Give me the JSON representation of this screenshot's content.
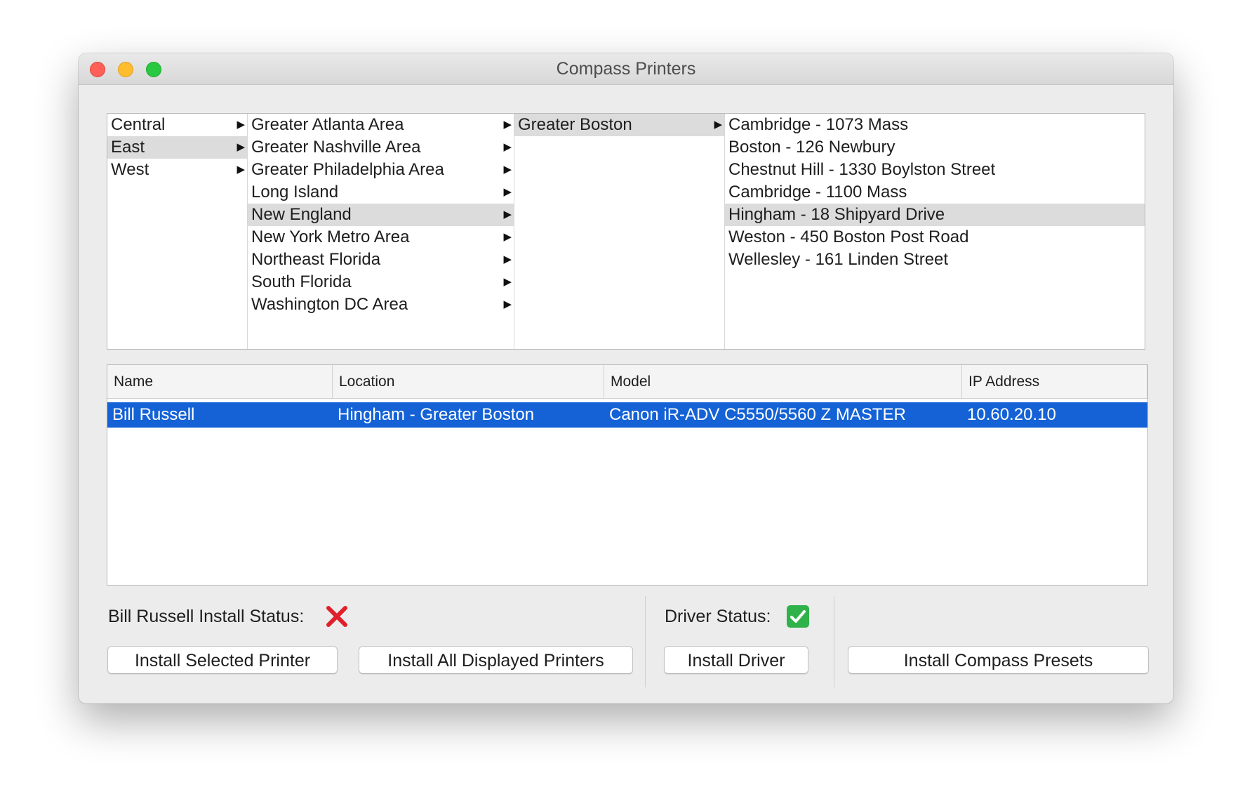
{
  "window": {
    "title": "Compass Printers"
  },
  "browser": {
    "regions": [
      {
        "label": "Central",
        "selected": false
      },
      {
        "label": "East",
        "selected": true
      },
      {
        "label": "West",
        "selected": false
      }
    ],
    "areas": [
      {
        "label": "Greater Atlanta Area",
        "selected": false
      },
      {
        "label": "Greater Nashville Area",
        "selected": false
      },
      {
        "label": "Greater Philadelphia Area",
        "selected": false
      },
      {
        "label": "Long Island",
        "selected": false
      },
      {
        "label": "New England",
        "selected": true
      },
      {
        "label": "New York Metro Area",
        "selected": false
      },
      {
        "label": "Northeast Florida",
        "selected": false
      },
      {
        "label": "South Florida",
        "selected": false
      },
      {
        "label": "Washington DC Area",
        "selected": false
      }
    ],
    "subareas": [
      {
        "label": "Greater Boston",
        "selected": true
      }
    ],
    "offices": [
      {
        "label": "Cambridge - 1073 Mass",
        "selected": false
      },
      {
        "label": "Boston - 126 Newbury",
        "selected": false
      },
      {
        "label": "Chestnut Hill - 1330 Boylston Street",
        "selected": false
      },
      {
        "label": "Cambridge - 1100 Mass",
        "selected": false
      },
      {
        "label": "Hingham - 18 Shipyard Drive",
        "selected": true
      },
      {
        "label": "Weston - 450 Boston Post Road",
        "selected": false
      },
      {
        "label": "Wellesley - 161 Linden Street",
        "selected": false
      }
    ],
    "arrow_glyph": "▶"
  },
  "table": {
    "columns": [
      "Name",
      "Location",
      "Model",
      "IP Address"
    ],
    "rows": [
      {
        "name": "Bill Russell",
        "location": "Hingham - Greater  Boston",
        "model": "Canon iR-ADV C5550/5560 Z MASTER",
        "ip": "10.60.20.10",
        "selected": true
      }
    ]
  },
  "status": {
    "install_status_label": "Bill Russell Install Status:",
    "install_status_icon": "cross-icon",
    "install_status_color": "#e0202a",
    "driver_status_label": "Driver Status:",
    "driver_status_icon": "check-icon",
    "driver_status_color": "#2fb24a"
  },
  "buttons": {
    "install_selected": "Install Selected Printer",
    "install_all": "Install All Displayed Printers",
    "install_driver": "Install Driver",
    "install_presets": "Install Compass Presets"
  },
  "colors": {
    "selection_blue": "#1462d6",
    "browser_selection_gray": "#dcdcdc"
  }
}
